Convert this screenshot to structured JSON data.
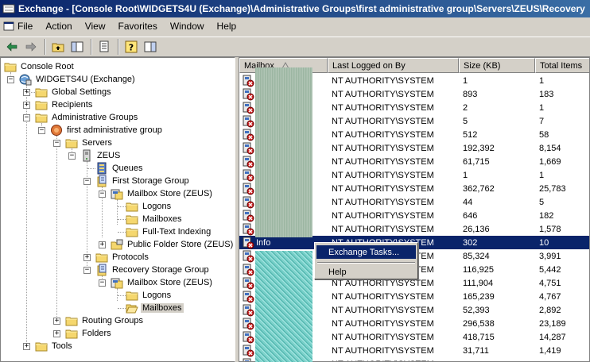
{
  "window": {
    "title": "Exchange - [Console Root\\WIDGETS4U  (Exchange)\\Administrative Groups\\first administrative group\\Servers\\ZEUS\\Recovery"
  },
  "menu": [
    {
      "label": "File"
    },
    {
      "label": "Action"
    },
    {
      "label": "View"
    },
    {
      "label": "Favorites"
    },
    {
      "label": "Window"
    },
    {
      "label": "Help"
    }
  ],
  "tree": {
    "nodes": [
      {
        "label": "Console Root"
      },
      {
        "label": "WIDGETS4U (Exchange)"
      },
      {
        "label": "Global Settings"
      },
      {
        "label": "Recipients"
      },
      {
        "label": "Administrative Groups"
      },
      {
        "label": "first administrative group"
      },
      {
        "label": "Servers"
      },
      {
        "label": "ZEUS"
      },
      {
        "label": "Queues"
      },
      {
        "label": "First Storage Group"
      },
      {
        "label": "Mailbox Store (ZEUS)"
      },
      {
        "label": "Logons"
      },
      {
        "label": "Mailboxes"
      },
      {
        "label": "Full-Text Indexing"
      },
      {
        "label": "Public Folder Store (ZEUS)"
      },
      {
        "label": "Protocols"
      },
      {
        "label": "Recovery Storage Group"
      },
      {
        "label": "Mailbox Store (ZEUS)"
      },
      {
        "label": "Logons"
      },
      {
        "label": "Mailboxes"
      },
      {
        "label": "Routing Groups"
      },
      {
        "label": "Folders"
      },
      {
        "label": "Tools"
      }
    ]
  },
  "list": {
    "columns": [
      {
        "label": "Mailbox"
      },
      {
        "label": "Last Logged on By"
      },
      {
        "label": "Size (KB)"
      },
      {
        "label": "Total Items"
      }
    ],
    "rows": [
      {
        "name": "",
        "by": "NT AUTHORITY\\SYSTEM",
        "size": "1",
        "items": "1"
      },
      {
        "name": "",
        "by": "NT AUTHORITY\\SYSTEM",
        "size": "893",
        "items": "183"
      },
      {
        "name": "...",
        "by": "NT AUTHORITY\\SYSTEM",
        "size": "2",
        "items": "1"
      },
      {
        "name": "",
        "by": "NT AUTHORITY\\SYSTEM",
        "size": "5",
        "items": "7"
      },
      {
        "name": "",
        "by": "NT AUTHORITY\\SYSTEM",
        "size": "512",
        "items": "58"
      },
      {
        "name": "",
        "by": "NT AUTHORITY\\SYSTEM",
        "size": "192,392",
        "items": "8,154"
      },
      {
        "name": "",
        "by": "NT AUTHORITY\\SYSTEM",
        "size": "61,715",
        "items": "1,669"
      },
      {
        "name": "",
        "by": "NT AUTHORITY\\SYSTEM",
        "size": "1",
        "items": "1"
      },
      {
        "name": "d",
        "by": "NT AUTHORITY\\SYSTEM",
        "size": "362,762",
        "items": "25,783"
      },
      {
        "name": "",
        "by": "NT AUTHORITY\\SYSTEM",
        "size": "44",
        "items": "5"
      },
      {
        "name": "",
        "by": "NT AUTHORITY\\SYSTEM",
        "size": "646",
        "items": "182"
      },
      {
        "name": "",
        "by": "NT AUTHORITY\\SYSTEM",
        "size": "26,136",
        "items": "1,578"
      },
      {
        "name": "Info",
        "by": "NT AUTHORITY\\SYSTEM",
        "size": "302",
        "items": "10"
      },
      {
        "name": "",
        "by": "NT AUTHORITY\\SYSTEM",
        "size": "85,324",
        "items": "3,991"
      },
      {
        "name": "",
        "by": "NT AUTHORITY\\SYSTEM",
        "size": "116,925",
        "items": "5,442"
      },
      {
        "name": "",
        "by": "NT AUTHORITY\\SYSTEM",
        "size": "111,904",
        "items": "4,751"
      },
      {
        "name": "",
        "by": "NT AUTHORITY\\SYSTEM",
        "size": "165,239",
        "items": "4,767"
      },
      {
        "name": "uce",
        "by": "NT AUTHORITY\\SYSTEM",
        "size": "52,393",
        "items": "2,892"
      },
      {
        "name": "",
        "by": "NT AUTHORITY\\SYSTEM",
        "size": "296,538",
        "items": "23,189"
      },
      {
        "name": "",
        "by": "NT AUTHORITY\\SYSTEM",
        "size": "418,715",
        "items": "14,287"
      },
      {
        "name": "s",
        "by": "NT AUTHORITY\\SYSTEM",
        "size": "31,711",
        "items": "1,419"
      },
      {
        "name": "",
        "by": "NT AUTHORITY\\SYSTEM",
        "size": "",
        "items": ""
      }
    ]
  },
  "context_menu": {
    "items": [
      {
        "label": "Exchange Tasks..."
      },
      {
        "label": "Help"
      }
    ]
  },
  "colors": {
    "selection": "#0a246a",
    "chrome": "#d4d0c8"
  }
}
